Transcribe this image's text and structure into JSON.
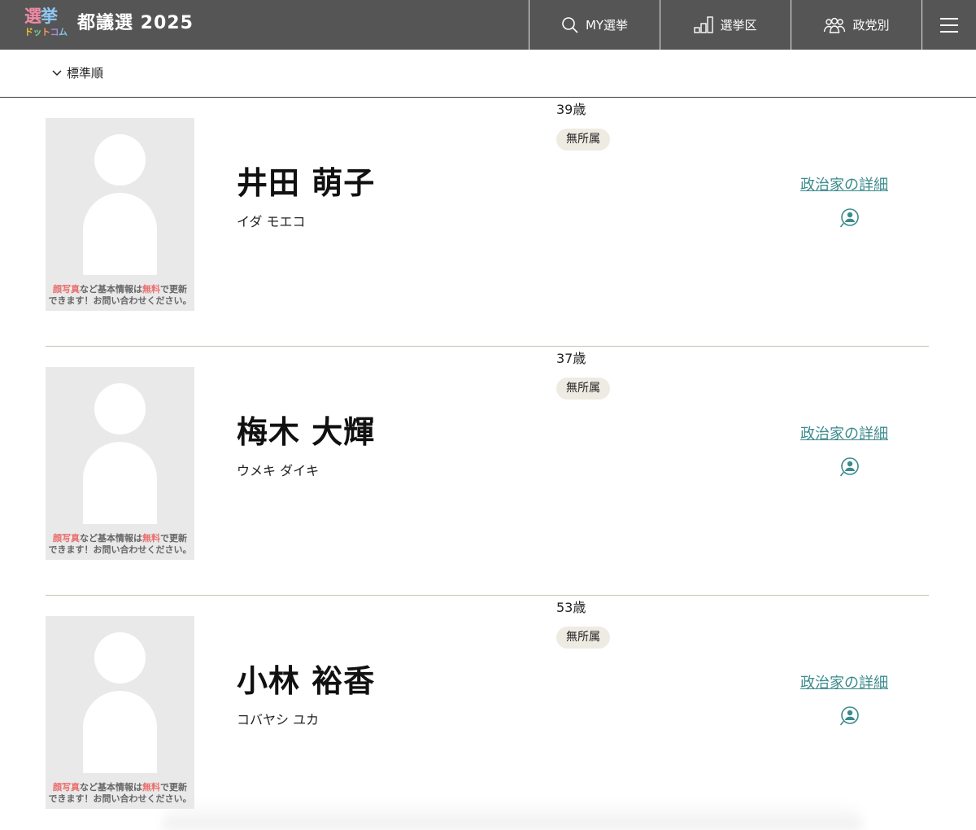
{
  "header": {
    "logo": {
      "top_chars": [
        "選",
        "挙"
      ],
      "bottom_chars": [
        "ド",
        "ッ",
        "ト",
        "コ",
        "ム"
      ]
    },
    "title": "都議選 2025",
    "nav": [
      {
        "label": "MY選挙",
        "icon": "search-icon"
      },
      {
        "label": "選挙区",
        "icon": "district-icon"
      },
      {
        "label": "政党別",
        "icon": "people-group-icon"
      }
    ],
    "menu_icon": "hamburger-menu-icon",
    "background_color": "#555555"
  },
  "sort": {
    "label": "標準順",
    "icon": "chevron-down-icon"
  },
  "photo_notice": {
    "part1": "顔写真",
    "part2": "など基本情報は",
    "part3": "無料",
    "part4": "で更新",
    "line2": "できます！お問い合わせください。"
  },
  "candidates": [
    {
      "name": "井田 萌子",
      "kana": "イダ モエコ",
      "age": "39歳",
      "party": "無所属",
      "detail_label": "政治家の詳細"
    },
    {
      "name": "梅木 大輝",
      "kana": "ウメキ ダイキ",
      "age": "37歳",
      "party": "無所属",
      "detail_label": "政治家の詳細"
    },
    {
      "name": "小林 裕香",
      "kana": "コバヤシ ユカ",
      "age": "53歳",
      "party": "無所属",
      "detail_label": "政治家の詳細"
    }
  ],
  "colors": {
    "link": "#3b8a8c",
    "party_badge": "#eeebe2",
    "notice_highlight": "#e8706f",
    "divider": "#c9c2b6"
  }
}
